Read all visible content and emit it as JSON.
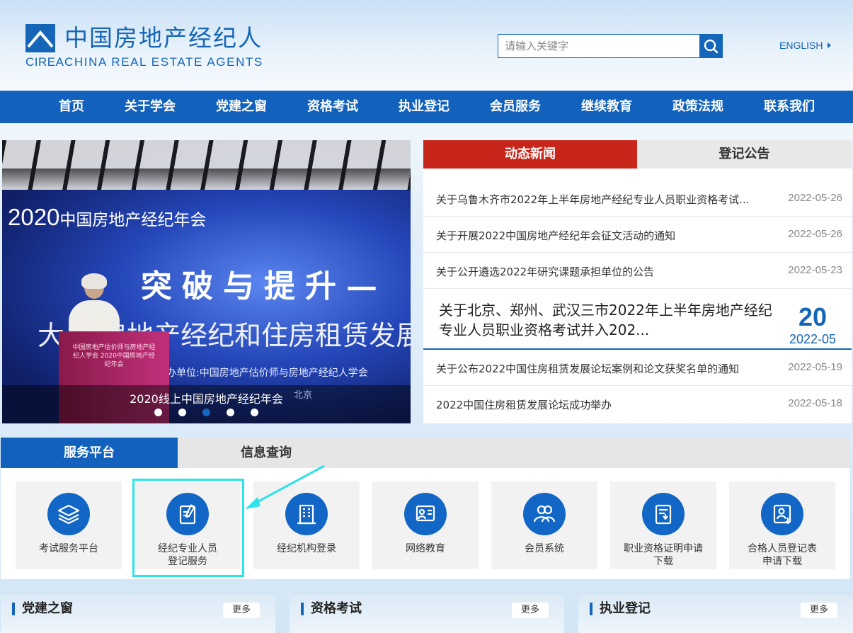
{
  "header": {
    "logo_cn": "中国房地产经纪人",
    "logo_abbr": "CIREA",
    "logo_en": "CHINA REAL ESTATE AGENTS",
    "search_placeholder": "请输入关键字",
    "language_link": "ENGLISH"
  },
  "nav": {
    "items": [
      "首页",
      "关于学会",
      "党建之窗",
      "资格考试",
      "执业登记",
      "会员服务",
      "继续教育",
      "政策法规",
      "联系我们"
    ]
  },
  "banner": {
    "caption": "2020线上中国房地产经纪年会",
    "slide_year": "2020",
    "slide_title": "中国房地产经纪年会",
    "slide_theme": "突破与提升—",
    "slide_subtitle": "大 下房地产经纪和住房租赁发展",
    "slide_organizer": "办单位:中国房地产估价师与房地产经纪人学会",
    "slide_city": "北京",
    "podium_text": "中国房地产估价师与房地产经纪人学会 2020中国房地产经纪年会",
    "dots_count": 5,
    "active_dot": 3
  },
  "news": {
    "tabs": [
      "动态新闻",
      "登记公告"
    ],
    "active_tab": "动态新闻",
    "items": [
      {
        "title": "关于乌鲁木齐市2022年上半年房地产经纪专业人员职业资格考试...",
        "date": "2022-05-26"
      },
      {
        "title": "关于开展2022中国房地产经纪年会征文活动的通知",
        "date": "2022-05-26"
      },
      {
        "title": "关于公开遴选2022年研究课题承担单位的公告",
        "date": "2022-05-23"
      }
    ],
    "featured": {
      "title": "关于北京、郑州、武汉三市2022年上半年房地产经纪专业人员职业资格考试并入202...",
      "day": "20",
      "year_month": "2022-05"
    },
    "items_after": [
      {
        "title": "关于公布2022中国住房租赁发展论坛案例和论文获奖名单的通知",
        "date": "2022-05-19"
      },
      {
        "title": "2022中国住房租赁发展论坛成功举办",
        "date": "2022-05-18"
      }
    ]
  },
  "services": {
    "tabs": [
      "服务平台",
      "信息查询"
    ],
    "active_tab": "服务平台",
    "cards": [
      {
        "label": "考试服务平台",
        "icon": "layers-icon"
      },
      {
        "label": "经纪专业人员\n登记服务",
        "icon": "document-edit-icon"
      },
      {
        "label": "经纪机构登录",
        "icon": "building-icon"
      },
      {
        "label": "网络教育",
        "icon": "online-learning-icon"
      },
      {
        "label": "会员系统",
        "icon": "members-icon"
      },
      {
        "label": "职业资格证明申请\n下载",
        "icon": "certificate-download-icon"
      },
      {
        "label": "合格人员登记表\n申请下载",
        "icon": "registration-form-download-icon"
      }
    ],
    "highlighted_card": "经纪专业人员登记服务"
  },
  "sections": [
    {
      "title": "党建之窗",
      "more": "更多"
    },
    {
      "title": "资格考试",
      "more": "更多"
    },
    {
      "title": "执业登记",
      "more": "更多"
    }
  ],
  "colors": {
    "brand_blue": "#1262bd",
    "news_red": "#c8261b",
    "highlight_cyan": "#2de3ea"
  }
}
